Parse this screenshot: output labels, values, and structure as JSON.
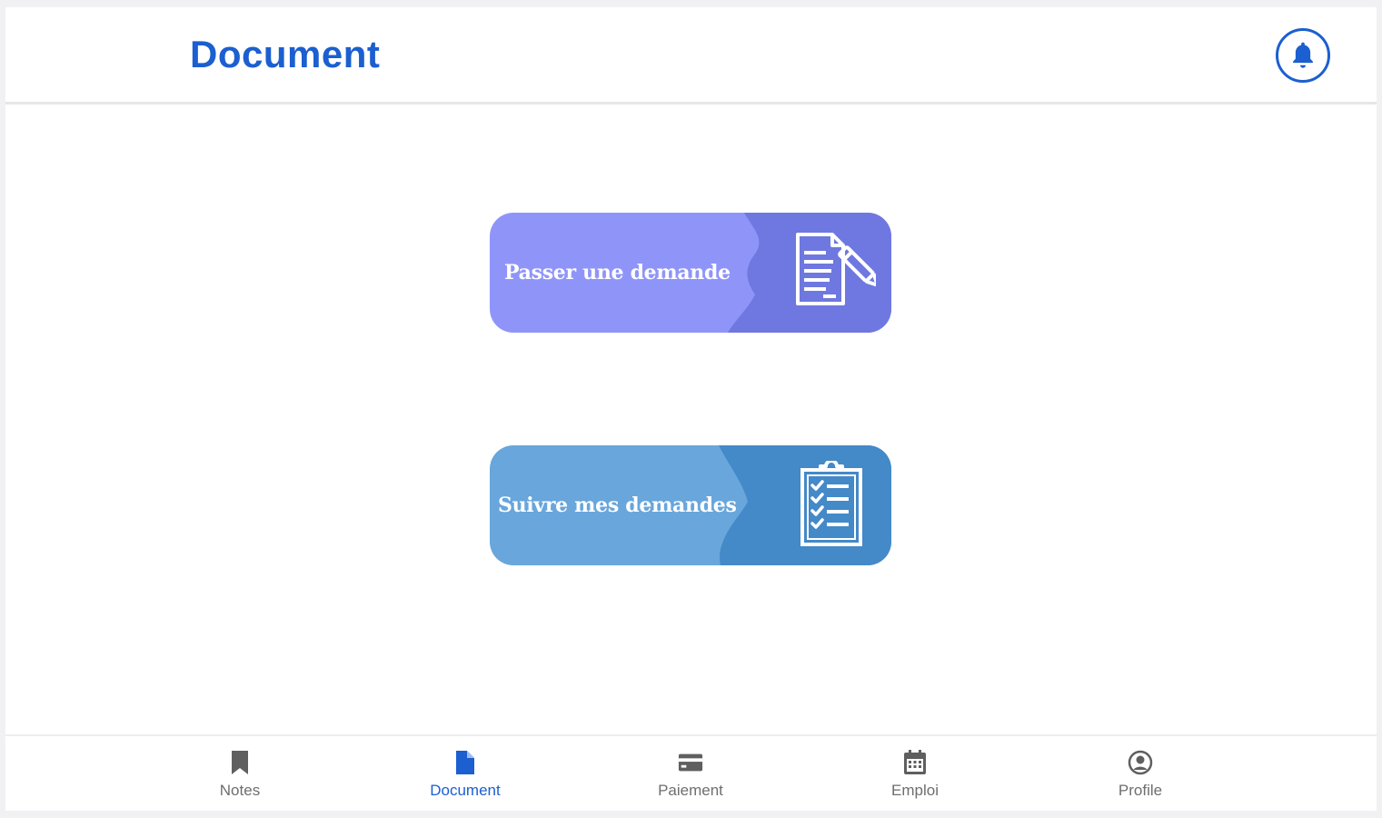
{
  "header": {
    "title": "Document",
    "notification_icon": "bell-icon"
  },
  "cards": [
    {
      "label": "Passer une demande",
      "icon": "document-edit-icon",
      "color": "#8f95f8",
      "accent": "#6e78e0"
    },
    {
      "label": "Suivre mes demandes",
      "icon": "clipboard-checklist-icon",
      "color": "#68a6dc",
      "accent": "#4489c8"
    }
  ],
  "bottom_nav": {
    "items": [
      {
        "label": "Notes",
        "icon": "bookmark-icon",
        "active": false
      },
      {
        "label": "Document",
        "icon": "file-icon",
        "active": true
      },
      {
        "label": "Paiement",
        "icon": "credit-card-icon",
        "active": false
      },
      {
        "label": "Emploi",
        "icon": "calendar-icon",
        "active": false
      },
      {
        "label": "Profile",
        "icon": "account-circle-icon",
        "active": false
      }
    ]
  },
  "colors": {
    "primary": "#1b5fd0",
    "inactive": "#6e6e6e"
  }
}
